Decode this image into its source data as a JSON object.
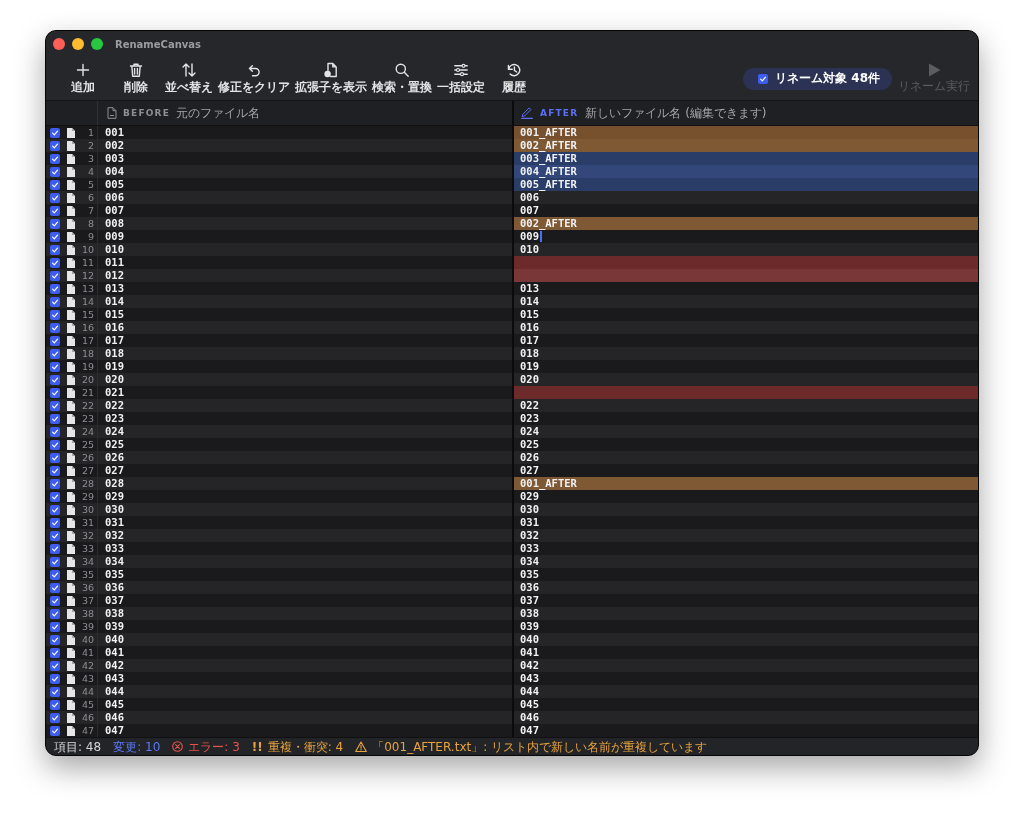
{
  "window": {
    "title": "RenameCanvas"
  },
  "toolbar": {
    "buttons": [
      {
        "label": "追加"
      },
      {
        "label": "削除"
      },
      {
        "label": "並べ替え"
      },
      {
        "label": "修正をクリア"
      },
      {
        "label": "拡張子を表示"
      },
      {
        "label": "検索・置換"
      },
      {
        "label": "一括設定"
      },
      {
        "label": "履歴"
      }
    ],
    "rename_target": {
      "label": "リネーム対象 48件",
      "checked": true
    },
    "run_button": {
      "label": "リネーム実行",
      "disabled": true
    }
  },
  "before_column": {
    "title": "BEFORE",
    "subtitle": "元のファイル名"
  },
  "after_column": {
    "title": "AFTER",
    "subtitle": "新しいファイル名 (編集できます)"
  },
  "rows": [
    {
      "number": "1",
      "checked": true,
      "before": "001",
      "after": "001_AFTER",
      "kind": "duplicate",
      "editing": false
    },
    {
      "number": "2",
      "checked": true,
      "before": "002",
      "after": "002_AFTER",
      "kind": "duplicate",
      "editing": false
    },
    {
      "number": "3",
      "checked": true,
      "before": "003",
      "after": "003_AFTER",
      "kind": "changed",
      "editing": false
    },
    {
      "number": "4",
      "checked": true,
      "before": "004",
      "after": "004_AFTER",
      "kind": "changed",
      "editing": false
    },
    {
      "number": "5",
      "checked": true,
      "before": "005",
      "after": "005_AFTER",
      "kind": "changed",
      "editing": false
    },
    {
      "number": "6",
      "checked": true,
      "before": "006",
      "after": "006",
      "kind": "unchanged",
      "editing": false
    },
    {
      "number": "7",
      "checked": true,
      "before": "007",
      "after": "007",
      "kind": "unchanged",
      "editing": false
    },
    {
      "number": "8",
      "checked": true,
      "before": "008",
      "after": "002_AFTER",
      "kind": "duplicate",
      "editing": false
    },
    {
      "number": "9",
      "checked": true,
      "before": "009",
      "after": "009",
      "kind": "unchanged",
      "editing": true
    },
    {
      "number": "10",
      "checked": true,
      "before": "010",
      "after": "010",
      "kind": "unchanged",
      "editing": false
    },
    {
      "number": "11",
      "checked": true,
      "before": "011",
      "kind": "error",
      "editing": false
    },
    {
      "number": "12",
      "checked": true,
      "before": "012",
      "kind": "error",
      "editing": false
    },
    {
      "number": "13",
      "checked": true,
      "before": "013",
      "after": "013",
      "kind": "unchanged",
      "editing": false
    },
    {
      "number": "14",
      "checked": true,
      "before": "014",
      "after": "014",
      "kind": "unchanged",
      "editing": false
    },
    {
      "number": "15",
      "checked": true,
      "before": "015",
      "after": "015",
      "kind": "unchanged",
      "editing": false
    },
    {
      "number": "16",
      "checked": true,
      "before": "016",
      "after": "016",
      "kind": "unchanged",
      "editing": false
    },
    {
      "number": "17",
      "checked": true,
      "before": "017",
      "after": "017",
      "kind": "unchanged",
      "editing": false
    },
    {
      "number": "18",
      "checked": true,
      "before": "018",
      "after": "018",
      "kind": "unchanged",
      "editing": false
    },
    {
      "number": "19",
      "checked": true,
      "before": "019",
      "after": "019",
      "kind": "unchanged",
      "editing": false
    },
    {
      "number": "20",
      "checked": true,
      "before": "020",
      "after": "020",
      "kind": "unchanged",
      "editing": false
    },
    {
      "number": "21",
      "checked": true,
      "before": "021",
      "kind": "error",
      "editing": false
    },
    {
      "number": "22",
      "checked": true,
      "before": "022",
      "after": "022",
      "kind": "unchanged",
      "editing": false
    },
    {
      "number": "23",
      "checked": true,
      "before": "023",
      "after": "023",
      "kind": "unchanged",
      "editing": false
    },
    {
      "number": "24",
      "checked": true,
      "before": "024",
      "after": "024",
      "kind": "unchanged",
      "editing": false
    },
    {
      "number": "25",
      "checked": true,
      "before": "025",
      "after": "025",
      "kind": "unchanged",
      "editing": false
    },
    {
      "number": "26",
      "checked": true,
      "before": "026",
      "after": "026",
      "kind": "unchanged",
      "editing": false
    },
    {
      "number": "27",
      "checked": true,
      "before": "027",
      "after": "027",
      "kind": "unchanged",
      "editing": false
    },
    {
      "number": "28",
      "checked": true,
      "before": "028",
      "after": "001_AFTER",
      "kind": "duplicate",
      "editing": false
    },
    {
      "number": "29",
      "checked": true,
      "before": "029",
      "after": "029",
      "kind": "unchanged",
      "editing": false
    },
    {
      "number": "30",
      "checked": true,
      "before": "030",
      "after": "030",
      "kind": "unchanged",
      "editing": false
    },
    {
      "number": "31",
      "checked": true,
      "before": "031",
      "after": "031",
      "kind": "unchanged",
      "editing": false
    },
    {
      "number": "32",
      "checked": true,
      "before": "032",
      "after": "032",
      "kind": "unchanged",
      "editing": false
    },
    {
      "number": "33",
      "checked": true,
      "before": "033",
      "after": "033",
      "kind": "unchanged",
      "editing": false
    },
    {
      "number": "34",
      "checked": true,
      "before": "034",
      "after": "034",
      "kind": "unchanged",
      "editing": false
    },
    {
      "number": "35",
      "checked": true,
      "before": "035",
      "after": "035",
      "kind": "unchanged",
      "editing": false
    },
    {
      "number": "36",
      "checked": true,
      "before": "036",
      "after": "036",
      "kind": "unchanged",
      "editing": false
    },
    {
      "number": "37",
      "checked": true,
      "before": "037",
      "after": "037",
      "kind": "unchanged",
      "editing": false
    },
    {
      "number": "38",
      "checked": true,
      "before": "038",
      "after": "038",
      "kind": "unchanged",
      "editing": false
    },
    {
      "number": "39",
      "checked": true,
      "before": "039",
      "after": "039",
      "kind": "unchanged",
      "editing": false
    },
    {
      "number": "40",
      "checked": true,
      "before": "040",
      "after": "040",
      "kind": "unchanged",
      "editing": false
    },
    {
      "number": "41",
      "checked": true,
      "before": "041",
      "after": "041",
      "kind": "unchanged",
      "editing": false
    },
    {
      "number": "42",
      "checked": true,
      "before": "042",
      "after": "042",
      "kind": "unchanged",
      "editing": false
    },
    {
      "number": "43",
      "checked": true,
      "before": "043",
      "after": "043",
      "kind": "unchanged",
      "editing": false
    },
    {
      "number": "44",
      "checked": true,
      "before": "044",
      "after": "044",
      "kind": "unchanged",
      "editing": false
    },
    {
      "number": "45",
      "checked": true,
      "before": "045",
      "after": "045",
      "kind": "unchanged",
      "editing": false
    },
    {
      "number": "46",
      "checked": true,
      "before": "046",
      "after": "046",
      "kind": "unchanged",
      "editing": false
    },
    {
      "number": "47",
      "checked": true,
      "before": "047",
      "after": "047",
      "kind": "unchanged",
      "editing": false
    }
  ],
  "status_bar": {
    "items": [
      {
        "kind": "count",
        "text": "項目: 48"
      },
      {
        "kind": "changed",
        "text": "変更: 10"
      },
      {
        "kind": "error",
        "text": "エラー: 3"
      },
      {
        "kind": "conflict",
        "marker": "!!",
        "text": "重複・衝突: 4"
      },
      {
        "kind": "warning",
        "text": "「001_AFTER.txt」: リスト内で新しい名前が重複しています"
      }
    ]
  }
}
